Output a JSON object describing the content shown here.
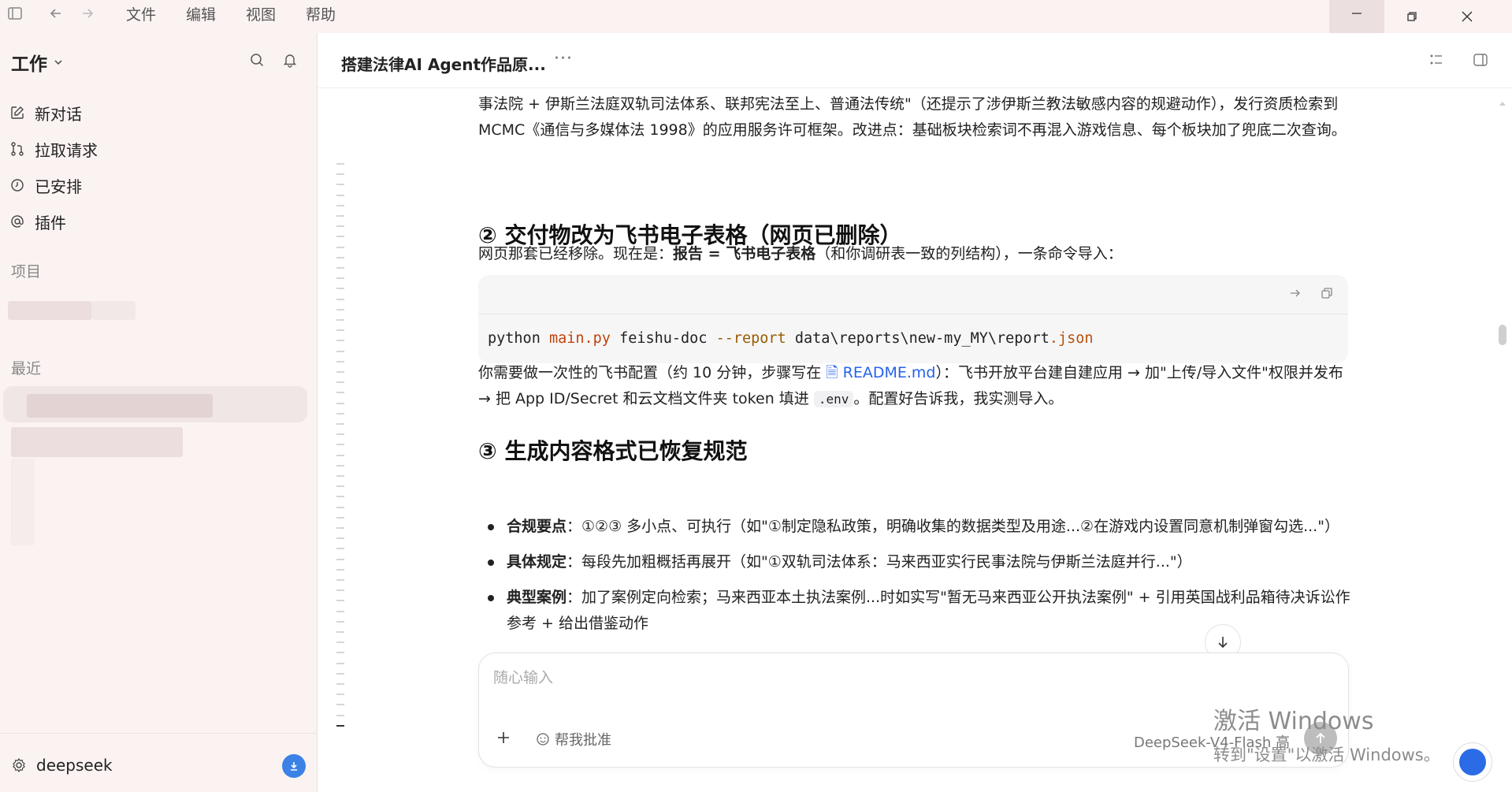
{
  "menubar": {
    "items": [
      "文件",
      "编辑",
      "视图",
      "帮助"
    ]
  },
  "sidebar": {
    "workspace": "工作",
    "nav": [
      {
        "label": "新对话",
        "icon": "edit-icon"
      },
      {
        "label": "拉取请求",
        "icon": "pull-request-icon"
      },
      {
        "label": "已安排",
        "icon": "clock-icon"
      },
      {
        "label": "插件",
        "icon": "at-icon"
      }
    ],
    "projects_label": "项目",
    "recent_label": "最近",
    "user": "deepseek"
  },
  "header": {
    "title": "搭建法律AI Agent作品原...",
    "more": "···"
  },
  "content": {
    "intro": "事法院 + 伊斯兰法庭双轨司法体系、联邦宪法至上、普通法传统\"（还提示了涉伊斯兰教法敏感内容的规避动作），发行资质检索到 MCMC《通信与多媒体法 1998》的应用服务许可框架。改进点：基础板块检索词不再混入游戏信息、每个板块加了兜底二次查询。",
    "section2_title": "② 交付物改为飞书电子表格（网页已删除）",
    "section2_pre": "网页那套已经移除。现在是：",
    "section2_bold1": "报告",
    "section2_eq": " = ",
    "section2_bold2": "飞书电子表格",
    "section2_post": "（和你调研表一致的列结构），一条命令导入：",
    "code": {
      "cmd": "python ",
      "file": "main.py",
      "sub": " feishu-doc ",
      "flag": "--report",
      "path": " data\\reports\\new-my_MY\\report",
      "ext": ".json"
    },
    "config_pre": "你需要做一次性的飞书配置（约 10 分钟，步骤写在 ",
    "config_link": "README.md",
    "config_mid": "）：飞书开放平台建自建应用 → 加\"上传/导入文件\"权限并发布 → 把 App ID/Secret 和云文档文件夹 token 填进 ",
    "config_code": ".env",
    "config_post": "。配置好告诉我，我实测导入。",
    "section3_title": "③ 生成内容格式已恢复规范",
    "bullets": [
      {
        "bold": "合规要点",
        "text": "：①②③ 多小点、可执行（如\"①制定隐私政策，明确收集的数据类型及用途...②在游戏内设置同意机制弹窗勾选...\"）"
      },
      {
        "bold": "具体规定",
        "text": "：每段先加粗概括再展开（如\"①双轨司法体系：马来西亚实行民事法院与伊斯兰法庭并行...\"）"
      },
      {
        "bold": "典型案例",
        "text": "：加了案例定向检索；马来西亚本土执法案例...时如实写\"暂无马来西亚公开执法案例\" + 引用英国战利品箱待决诉讼作参考 + 给出借鉴动作"
      }
    ]
  },
  "composer": {
    "placeholder": "随心输入",
    "approve_label": "帮我批准",
    "model_label": "DeepSeek-V4-Flash 高"
  },
  "watermark": {
    "line1": "激活 Windows",
    "line2": "转到\"设置\"以激活 Windows。"
  }
}
